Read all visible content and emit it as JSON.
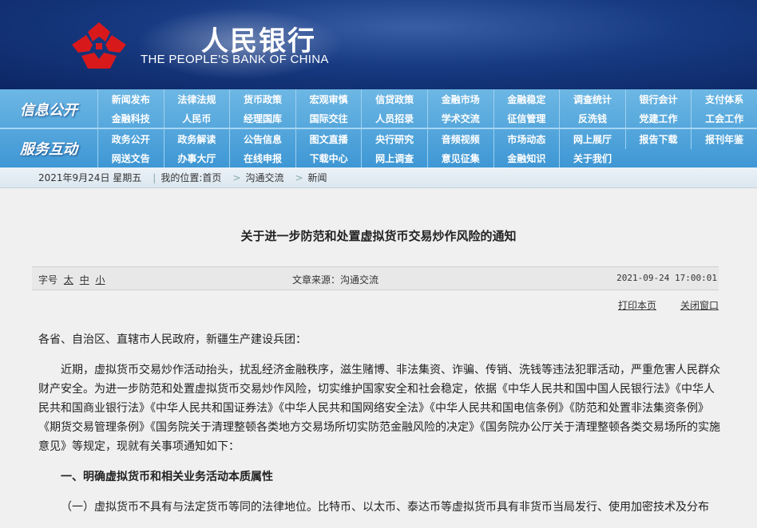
{
  "header": {
    "cn_name": "人民银行",
    "en_name": "THE PEOPLE'S BANK OF CHINA",
    "colors": {
      "primary": "#173a82",
      "logo": "#d8191c",
      "nav": "#4ba3dc"
    }
  },
  "nav": {
    "side_labels": [
      "信息公开",
      "服务互动"
    ],
    "rows": [
      [
        "新闻发布",
        "法律法规",
        "货币政策",
        "宏观审慎",
        "信贷政策",
        "金融市场",
        "金融稳定",
        "调查统计",
        "银行会计",
        "支付体系"
      ],
      [
        "金融科技",
        "人民币",
        "经理国库",
        "国际交往",
        "人员招录",
        "学术交流",
        "征信管理",
        "反洗钱",
        "党建工作",
        "工会工作"
      ],
      [
        "政务公开",
        "政务解读",
        "公告信息",
        "图文直播",
        "央行研究",
        "音频视频",
        "市场动态",
        "网上展厅",
        "报告下载",
        "报刊年鉴"
      ],
      [
        "网送文告",
        "办事大厅",
        "在线申报",
        "下载中心",
        "网上调查",
        "意见征集",
        "金融知识",
        "关于我们"
      ]
    ]
  },
  "breadcrumb": {
    "date": "2021年9月24日 星期五",
    "location_label": "我的位置:",
    "items": [
      "首页",
      "沟通交流",
      "新闻"
    ]
  },
  "article": {
    "title": "关于进一步防范和处置虚拟货币交易炒作风险的通知",
    "font_label": "字号",
    "font_sizes": [
      "太",
      "中",
      "小"
    ],
    "source": "文章来源：沟通交流",
    "datetime": "2021-09-24 17:00:01",
    "print_label": "打印本页",
    "close_label": "关闭窗口",
    "addressee": "各省、自治区、直辖市人民政府，新疆生产建设兵团：",
    "body": "近期，虚拟货币交易炒作活动抬头，扰乱经济金融秩序，滋生赌博、非法集资、诈骗、传销、洗钱等违法犯罪活动，严重危害人民群众财产安全。为进一步防范和处置虚拟货币交易炒作风险，切实维护国家安全和社会稳定，依据《中华人民共和国中国人民银行法》《中华人民共和国商业银行法》《中华人民共和国证券法》《中华人民共和国网络安全法》《中华人民共和国电信条例》《防范和处置非法集资条例》《期货交易管理条例》《国务院关于清理整顿各类地方交易场所切实防范金融风险的决定》《国务院办公厅关于清理整顿各类交易场所的实施意见》等规定，现就有关事项通知如下：",
    "section1": "一、明确虚拟货币和相关业务活动本质属性",
    "section1_p1": "（一）虚拟货币不具有与法定货币等同的法律地位。比特币、以太币、泰达币等虚拟货币具有非货币当局发行、使用加密技术及分布"
  }
}
